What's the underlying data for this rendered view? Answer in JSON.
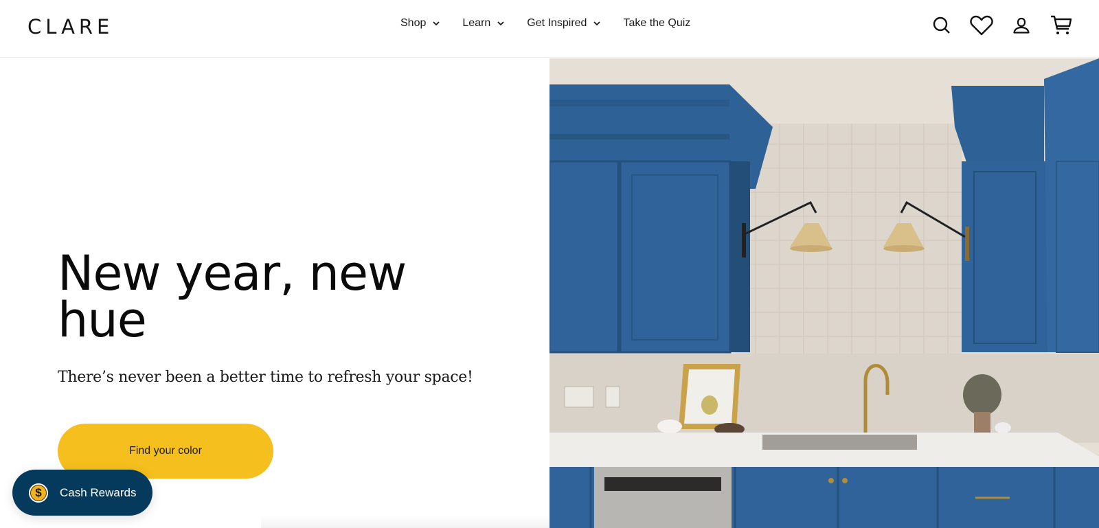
{
  "brand": {
    "logo": "CLARE"
  },
  "nav": {
    "items": [
      {
        "label": "Shop",
        "has_dropdown": true
      },
      {
        "label": "Learn",
        "has_dropdown": true
      },
      {
        "label": "Get Inspired",
        "has_dropdown": true
      },
      {
        "label": "Take the Quiz",
        "has_dropdown": false
      }
    ]
  },
  "header_icons": [
    "search-icon",
    "heart-icon",
    "account-icon",
    "cart-icon"
  ],
  "hero": {
    "headline": "New year, new hue",
    "subhead": "There’s never been a better time to refresh your space!",
    "cta_label": "Find your color",
    "image_alt": "Kitchen with blue cabinets, white tile backsplash and rattan wall sconces"
  },
  "rewards": {
    "label": "Cash Rewards",
    "icon": "dollar-coin-icon"
  },
  "colors": {
    "cta": "#f5bf1d",
    "rewards_bg": "#053a5c",
    "cabinet_blue": "#2f639a"
  }
}
